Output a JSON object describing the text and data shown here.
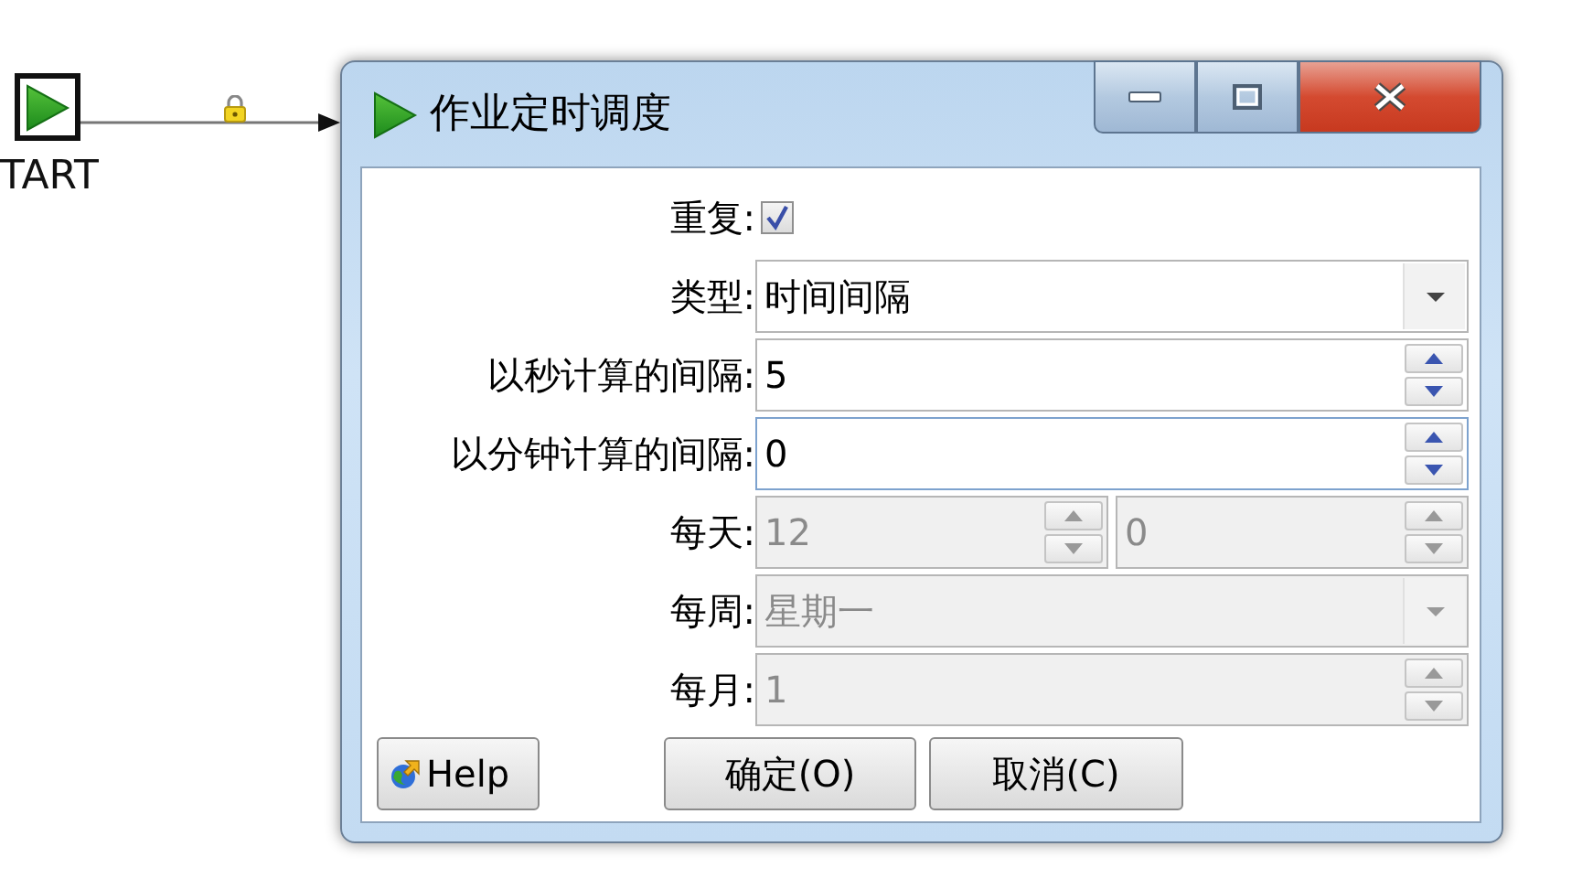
{
  "canvas": {
    "start_node": {
      "label": "TART"
    }
  },
  "dialog": {
    "title": "作业定时调度",
    "rows": [
      {
        "kind": "checkbox",
        "label": "重复:",
        "checked": true,
        "disabled": false
      },
      {
        "kind": "combo",
        "label": "类型:",
        "value": "时间间隔",
        "disabled": false
      },
      {
        "kind": "spin",
        "label": "以秒计算的间隔:",
        "value": "5",
        "disabled": false,
        "focused": false
      },
      {
        "kind": "spin",
        "label": "以分钟计算的间隔:",
        "value": "0",
        "disabled": false,
        "focused": true
      },
      {
        "kind": "spinpair",
        "label": "每天:",
        "value": "12",
        "value2": "0",
        "disabled": true
      },
      {
        "kind": "combo",
        "label": "每周:",
        "value": "星期一",
        "disabled": true
      },
      {
        "kind": "spin",
        "label": "每月:",
        "value": "1",
        "disabled": true,
        "focused": false
      }
    ],
    "help_button": "Help",
    "buttons": [
      "确定(O)",
      "取消(C)"
    ]
  }
}
